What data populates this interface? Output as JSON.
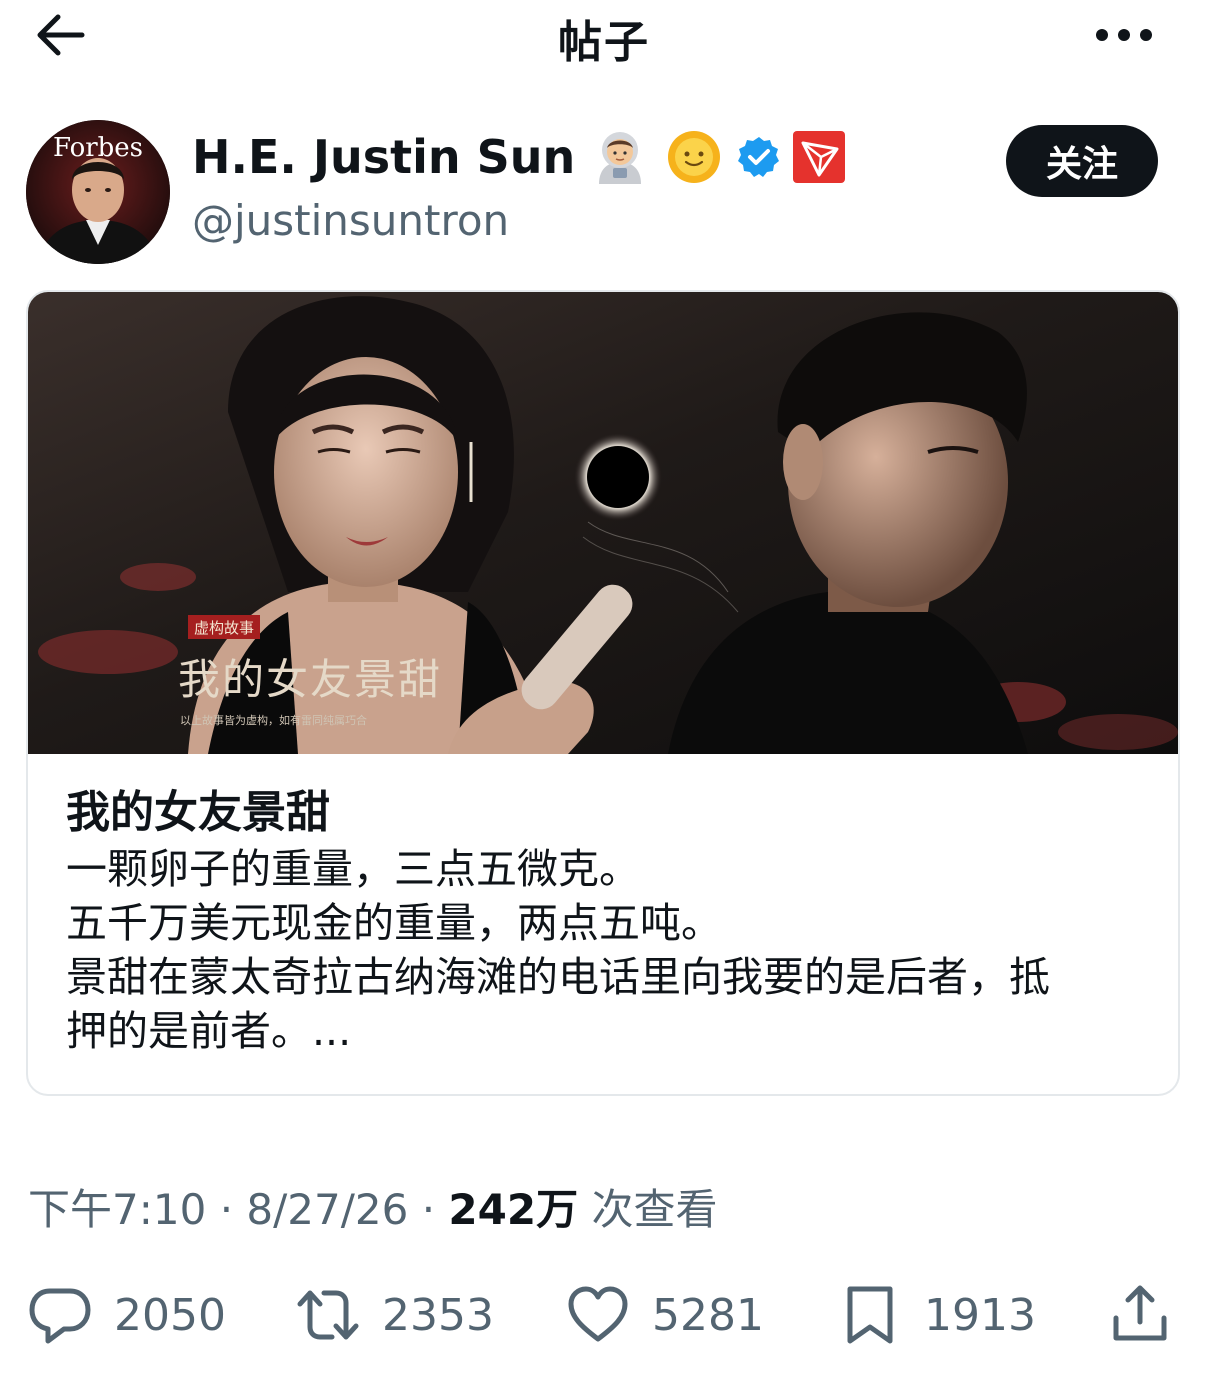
{
  "header": {
    "title": "帖子"
  },
  "author": {
    "display_name": "H.E. Justin Sun",
    "handle": "@justinsuntron",
    "follow_label": "关注",
    "avatar_text": "Forbes",
    "badges": [
      "astronaut-emoji",
      "sun-face-emoji",
      "verified-badge",
      "tron-logo"
    ]
  },
  "card": {
    "image": {
      "tag": "虚构故事",
      "title": "我的女友景甜",
      "disclaimer": "以上故事皆为虚构，如有雷同纯属巧合"
    },
    "title": "我的女友景甜",
    "lines": [
      "一颗卵子的重量，三点五微克。",
      "五千万美元现金的重量，两点五吨。",
      "景甜在蒙太奇拉古纳海滩的电话里向我要的是后者，抵",
      "押的是前者。..."
    ]
  },
  "meta": {
    "time": "下午7:10",
    "date": "8/27/26",
    "views": "242万",
    "views_label": "次查看",
    "sep": "·"
  },
  "actions": {
    "replies": "2050",
    "retweets": "2353",
    "likes": "5281",
    "bookmarks": "1913"
  },
  "colors": {
    "text": "#0f1419",
    "secondary": "#536471",
    "verified": "#1d9bf0",
    "tron": "#e5322d",
    "follow_bg": "#0f1419"
  }
}
